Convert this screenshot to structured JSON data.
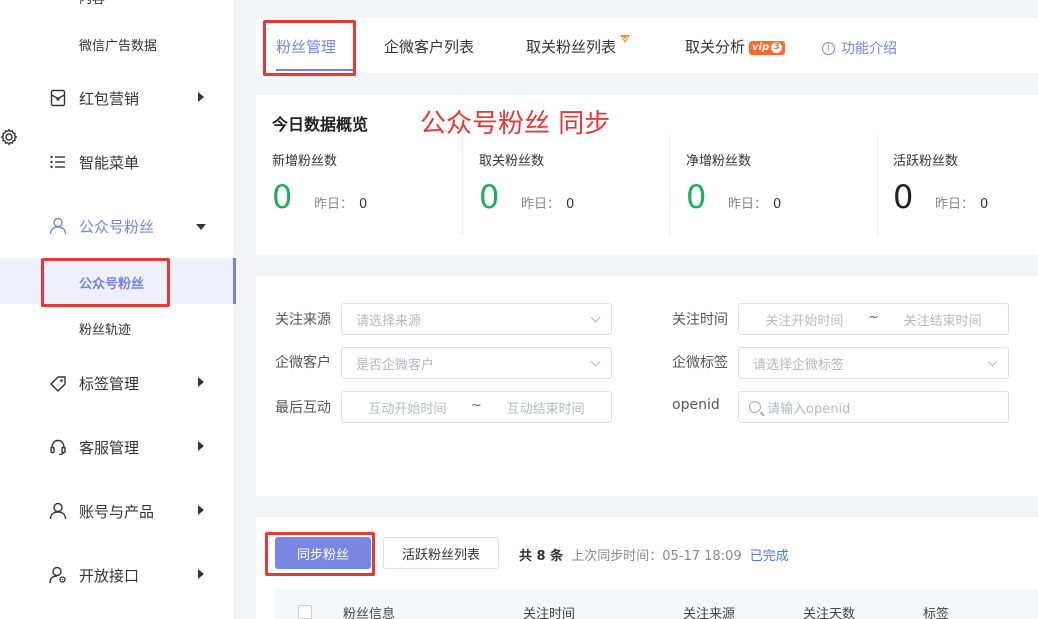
{
  "sidebar": {
    "top_cut": "内容",
    "wechat_ad": "微信广告数据",
    "items": [
      {
        "label": "红包营销",
        "icon": "red-packet-icon"
      },
      {
        "label": "智能菜单",
        "icon": "menu-list-icon"
      },
      {
        "label": "公众号粉丝",
        "icon": "user-icon"
      },
      {
        "label": "标签管理",
        "icon": "tag-icon"
      },
      {
        "label": "客服管理",
        "icon": "headset-icon"
      },
      {
        "label": "账号与产品",
        "icon": "account-icon"
      },
      {
        "label": "开放接口",
        "icon": "api-user-icon"
      }
    ],
    "sub_active": "公众号粉丝",
    "sub_track": "粉丝轨迹"
  },
  "tabs": {
    "items": [
      "粉丝管理",
      "企微客户列表",
      "取关粉丝列表",
      "取关分析"
    ],
    "vip_label": "vip",
    "vip_num": "3",
    "help": "功能介绍"
  },
  "stats": {
    "title": "今日数据概览",
    "annotation": "公众号粉丝 同步",
    "yesterday_label": "昨日：",
    "cards": [
      {
        "label": "新增粉丝数",
        "value": "0",
        "yesterday": "0"
      },
      {
        "label": "取关粉丝数",
        "value": "0",
        "yesterday": "0"
      },
      {
        "label": "净增粉丝数",
        "value": "0",
        "yesterday": "0"
      },
      {
        "label": "活跃粉丝数",
        "value": "0",
        "yesterday": "0"
      }
    ]
  },
  "filters": {
    "source_label": "关注来源",
    "source_placeholder": "请选择来源",
    "time_label": "关注时间",
    "time_start": "关注开始时间",
    "time_end": "关注结束时间",
    "wecom_label": "企微客户",
    "wecom_placeholder": "是否企微客户",
    "wecom_tag_label": "企微标签",
    "wecom_tag_placeholder": "请选择企微标签",
    "last_label": "最后互动",
    "last_start": "互动开始时间",
    "last_end": "互动结束时间",
    "openid_label": "openid",
    "openid_placeholder": "请输入openid",
    "tilde": "~"
  },
  "actions": {
    "sync_button": "同步粉丝",
    "active_list_button": "活跃粉丝列表",
    "total": "共 8 条",
    "last_sync": "上次同步时间：05-17 18:09",
    "status": "已完成"
  },
  "table": {
    "headers": [
      "粉丝信息",
      "关注时间",
      "关注来源",
      "关注天数",
      "标签"
    ]
  },
  "colors": {
    "accent": "#7783e4",
    "annotation_red": "#e53935",
    "green": "#1fae5f"
  }
}
